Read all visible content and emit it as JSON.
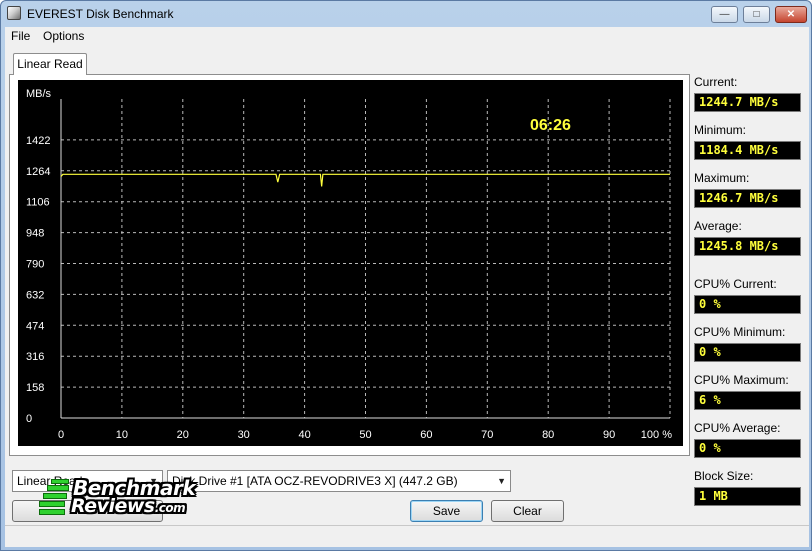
{
  "window": {
    "title": "EVEREST Disk Benchmark",
    "buttons": {
      "minimize": "—",
      "maximize": "□",
      "close": "✕"
    }
  },
  "menu": {
    "file": "File",
    "options": "Options"
  },
  "tab": {
    "label": "Linear Read"
  },
  "chart_data": {
    "type": "line",
    "ylabel": "MB/s",
    "y_ticks": [
      "1422",
      "1264",
      "1106",
      "948",
      "790",
      "632",
      "474",
      "316",
      "158",
      "0"
    ],
    "x_ticks": [
      "0",
      "10",
      "20",
      "30",
      "40",
      "50",
      "60",
      "70",
      "80",
      "90",
      "100 %"
    ],
    "ylim": [
      0,
      1580
    ],
    "xlim": [
      0,
      100
    ],
    "timer": "06:26",
    "grid": true,
    "series_color": "#ffff3c",
    "series": [
      {
        "values": [
          [
            0,
            1235
          ],
          [
            0.3,
            1246
          ],
          [
            35.3,
            1246
          ],
          [
            35.6,
            1206
          ],
          [
            35.9,
            1246
          ],
          [
            42.6,
            1246
          ],
          [
            42.8,
            1184
          ],
          [
            43.0,
            1246
          ],
          [
            100,
            1246
          ]
        ]
      }
    ]
  },
  "stats": {
    "current_label": "Current:",
    "current_value": "1244.7 MB/s",
    "minimum_label": "Minimum:",
    "minimum_value": "1184.4 MB/s",
    "maximum_label": "Maximum:",
    "maximum_value": "1246.7 MB/s",
    "average_label": "Average:",
    "average_value": "1245.8 MB/s",
    "cpu_current_label": "CPU% Current:",
    "cpu_current_value": "0 %",
    "cpu_minimum_label": "CPU% Minimum:",
    "cpu_minimum_value": "0 %",
    "cpu_maximum_label": "CPU% Maximum:",
    "cpu_maximum_value": "6 %",
    "cpu_average_label": "CPU% Average:",
    "cpu_average_value": "0 %",
    "block_size_label": "Block Size:",
    "block_size_value": "1 MB"
  },
  "controls": {
    "test_select": "Linear Read",
    "drive_select": "Disk Drive #1  [ATA     OCZ-REVODRIVE3 X]  (447.2 GB)",
    "save": "Save",
    "clear": "Clear"
  },
  "logo": {
    "line1": "Benchmark",
    "line2": "Reviews",
    "line2_suffix": ".com"
  }
}
